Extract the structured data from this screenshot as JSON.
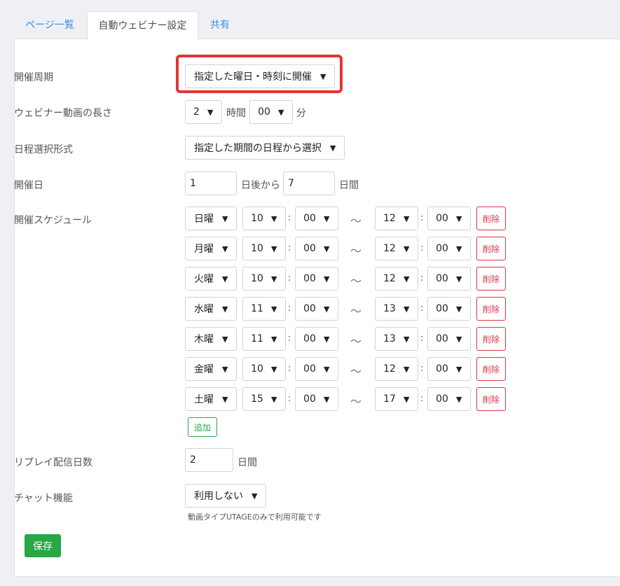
{
  "tabs": [
    "ページ一覧",
    "自動ウェビナー設定",
    "共有"
  ],
  "form": {
    "cycle": {
      "label": "開催周期",
      "value": "指定した曜日・時刻に開催"
    },
    "length": {
      "label": "ウェビナー動画の長さ",
      "hours": "2",
      "hours_unit": "時間",
      "minutes": "00",
      "minutes_unit": "分"
    },
    "selection": {
      "label": "日程選択形式",
      "value": "指定した期間の日程から選択"
    },
    "date": {
      "label": "開催日",
      "start": "1",
      "start_unit": "日後から",
      "days": "7",
      "days_unit": "日間"
    },
    "schedule": {
      "label": "開催スケジュール",
      "colon": ":",
      "tilde": "〜",
      "delete_label": "削除",
      "add_label": "追加",
      "rows": [
        {
          "day": "日曜",
          "start_h": "10",
          "start_m": "00",
          "end_h": "12",
          "end_m": "00"
        },
        {
          "day": "月曜",
          "start_h": "10",
          "start_m": "00",
          "end_h": "12",
          "end_m": "00"
        },
        {
          "day": "火曜",
          "start_h": "10",
          "start_m": "00",
          "end_h": "12",
          "end_m": "00"
        },
        {
          "day": "水曜",
          "start_h": "11",
          "start_m": "00",
          "end_h": "13",
          "end_m": "00"
        },
        {
          "day": "木曜",
          "start_h": "11",
          "start_m": "00",
          "end_h": "13",
          "end_m": "00"
        },
        {
          "day": "金曜",
          "start_h": "10",
          "start_m": "00",
          "end_h": "12",
          "end_m": "00"
        },
        {
          "day": "土曜",
          "start_h": "15",
          "start_m": "00",
          "end_h": "17",
          "end_m": "00"
        }
      ]
    },
    "replay": {
      "label": "リプレイ配信日数",
      "value": "2",
      "unit": "日間"
    },
    "chat": {
      "label": "チャット機能",
      "value": "利用しない",
      "note": "動画タイプUTAGEのみで利用可能です"
    }
  },
  "save_label": "保存",
  "colors": {
    "accent": "#3b8be6",
    "success": "#28a745",
    "danger": "#dc3545",
    "highlight": "#e03535"
  },
  "icons": {
    "dropdown": "chevron-down-icon"
  }
}
